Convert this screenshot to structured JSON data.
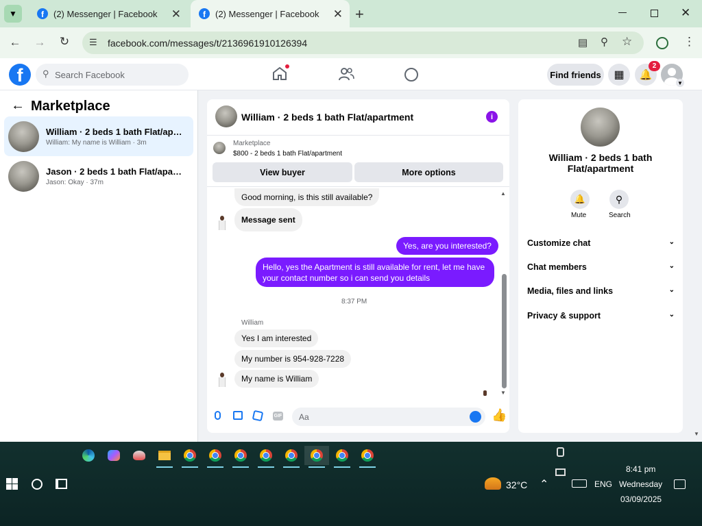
{
  "browser": {
    "tabs": [
      {
        "title": "(2) Messenger | Facebook",
        "active": false
      },
      {
        "title": "(2) Messenger | Facebook",
        "active": true
      }
    ],
    "new_tab_icon": "plus-icon",
    "url": "facebook.com/messages/t/2136961910126394"
  },
  "fb": {
    "search_placeholder": "Search Facebook",
    "find_friends": "Find friends",
    "notification_count": "2"
  },
  "left": {
    "title": "Marketplace",
    "conversations": [
      {
        "title": "William · 2 beds 1 bath Flat/apart...",
        "subtitle": "William: My name is William · 3m",
        "selected": true
      },
      {
        "title": "Jason · 2 beds 1 bath Flat/apartment",
        "subtitle": "Jason: Okay · 37m",
        "selected": false
      }
    ]
  },
  "chat": {
    "header_title": "William · 2 beds 1 bath Flat/apartment",
    "listing_label": "Marketplace",
    "listing_detail": "$800 - 2 beds 1 bath Flat/apartment",
    "view_buyer": "View buyer",
    "more_options": "More options",
    "messages": [
      {
        "text": "Good morning, is this still available?",
        "dir": "in"
      },
      {
        "text": "Message sent",
        "dir": "in"
      },
      {
        "text": "Yes, are you interested?",
        "dir": "out"
      },
      {
        "text_line1": "Hello, yes the Apartment is still available for rent, let me have",
        "text_line2": "your contact number so i can send you details",
        "dir": "out"
      },
      {
        "timestamp": "8:37 PM"
      },
      {
        "sender": "William"
      },
      {
        "text": "Yes I am interested",
        "dir": "in"
      },
      {
        "text": "My number is 954-928-7228",
        "dir": "in"
      },
      {
        "text": "My name is William",
        "dir": "in"
      }
    ],
    "composer_placeholder": "Aa"
  },
  "info": {
    "title": "William · 2 beds 1 bath Flat/apartment",
    "mute": "Mute",
    "search": "Search",
    "sections": [
      "Customize chat",
      "Chat members",
      "Media, files and links",
      "Privacy & support"
    ]
  },
  "taskbar": {
    "temperature": "32°C",
    "language": "ENG",
    "time": "8:41 pm",
    "day": "Wednesday",
    "date": "03/09/2025"
  },
  "colors": {
    "facebook_blue": "#1877f2",
    "messenger_purple": "#7a1bff",
    "notification_red": "#e41e3f"
  }
}
